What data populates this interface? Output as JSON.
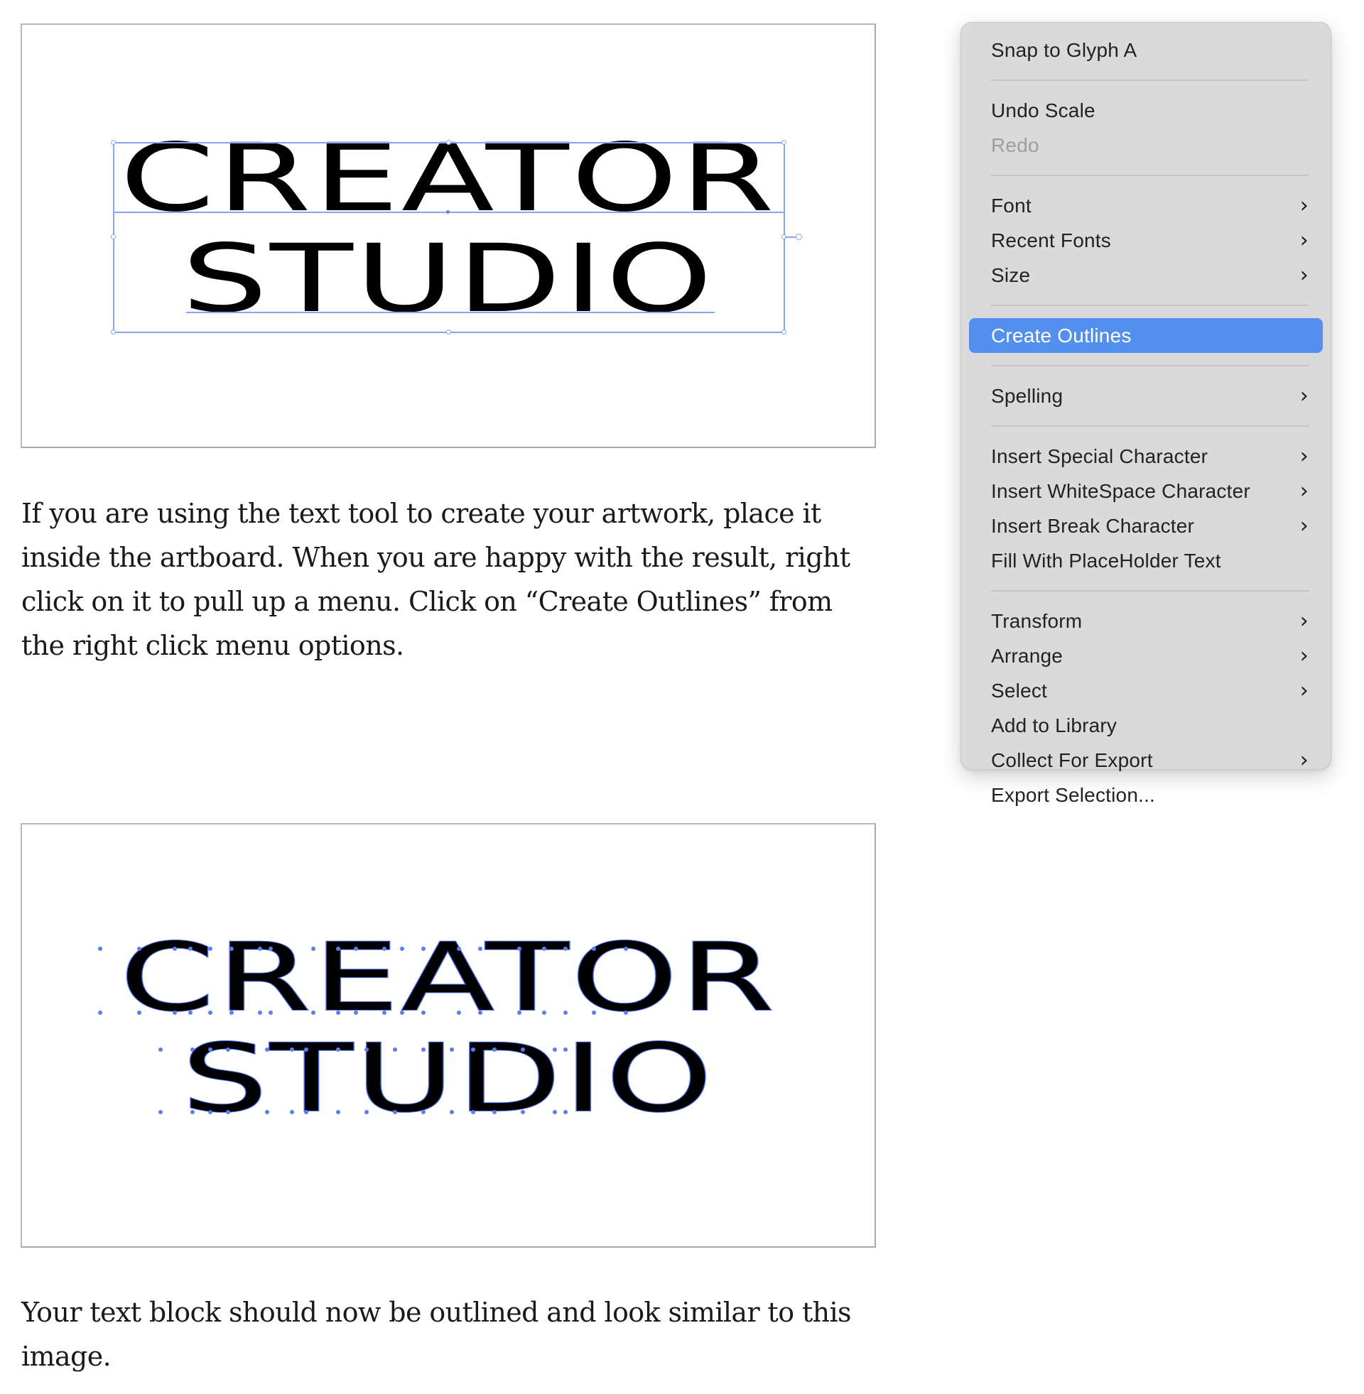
{
  "artboard_1": {
    "line_1": "CREATOR",
    "line_2": "STUDIO",
    "state": "text-selected"
  },
  "paragraph_1": "If you are using the text tool to create your artwork, place it inside the artboard. When you are happy with the result, right click on it to pull up a menu. Click on “Create Outlines” from the right click menu options.",
  "artboard_2": {
    "line_1": "CREATOR",
    "line_2": "STUDIO",
    "state": "outlined"
  },
  "paragraph_2": "Your text block should now be outlined and look similar to this image.",
  "context_menu": {
    "groups": [
      [
        {
          "label": "Snap to Glyph A",
          "submenu": false,
          "disabled": false
        }
      ],
      [
        {
          "label": "Undo Scale",
          "submenu": false,
          "disabled": false
        },
        {
          "label": "Redo",
          "submenu": false,
          "disabled": true
        }
      ],
      [
        {
          "label": "Font",
          "submenu": true
        },
        {
          "label": "Recent Fonts",
          "submenu": true
        },
        {
          "label": "Size",
          "submenu": true
        }
      ],
      [
        {
          "label": "Create Outlines",
          "submenu": false,
          "highlighted": true
        }
      ],
      [
        {
          "label": "Spelling",
          "submenu": true
        }
      ],
      [
        {
          "label": "Insert Special Character",
          "submenu": true
        },
        {
          "label": "Insert WhiteSpace Character",
          "submenu": true
        },
        {
          "label": "Insert Break Character",
          "submenu": true
        },
        {
          "label": "Fill With PlaceHolder Text",
          "submenu": false
        }
      ],
      [
        {
          "label": "Transform",
          "submenu": true
        },
        {
          "label": "Arrange",
          "submenu": true
        },
        {
          "label": "Select",
          "submenu": true
        },
        {
          "label": "Add to Library",
          "submenu": false
        },
        {
          "label": "Collect For Export",
          "submenu": true
        },
        {
          "label": "Export Selection...",
          "submenu": false
        }
      ]
    ],
    "chevron_glyph": "›"
  },
  "colors": {
    "menu_background": "#dadada",
    "highlight": "#5390ee",
    "selection_blue": "#8aa4f5",
    "anchor_blue": "#5b7ff2"
  }
}
